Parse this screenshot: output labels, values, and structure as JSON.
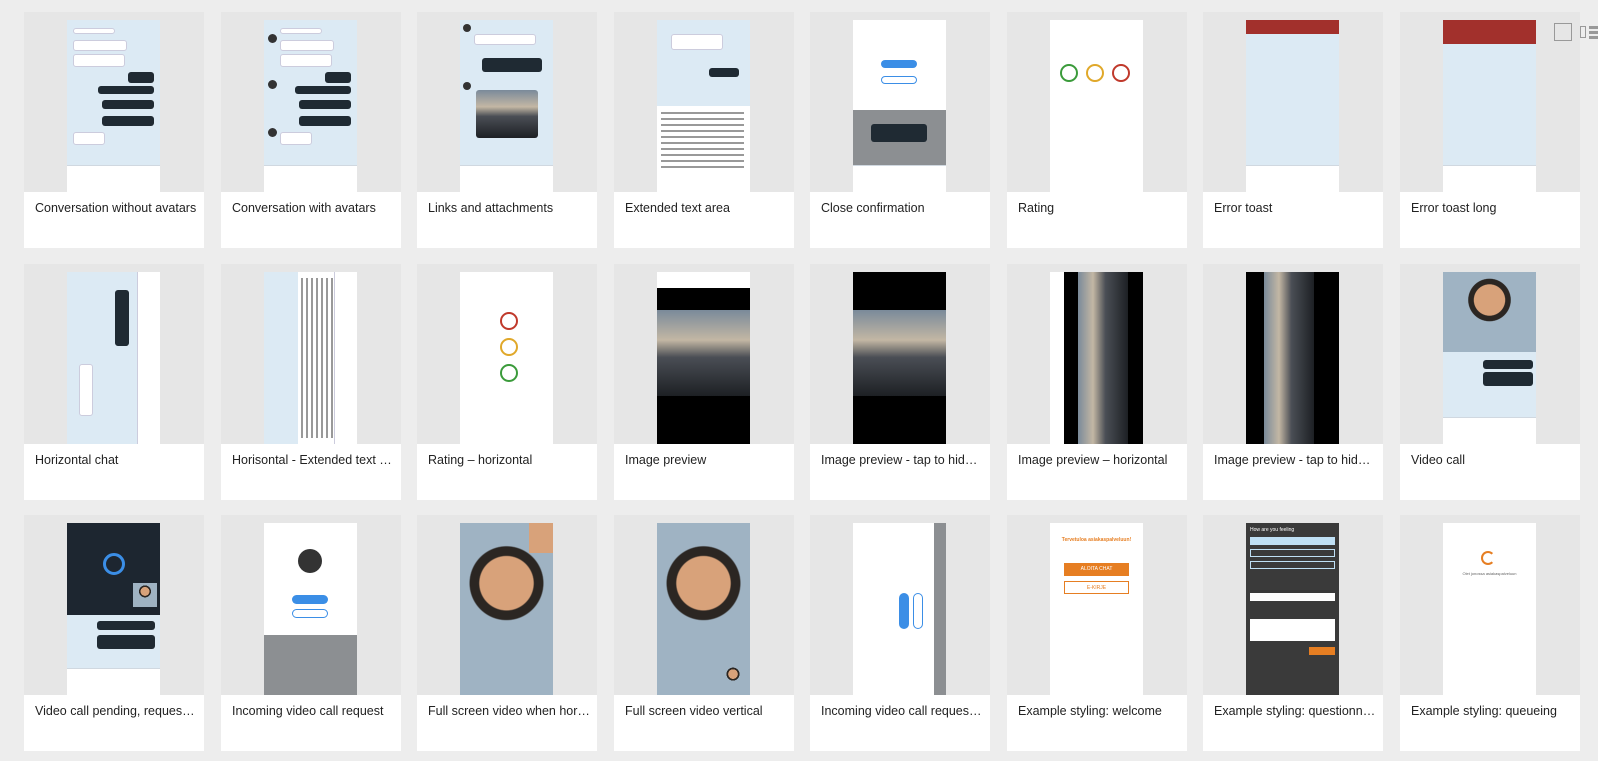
{
  "toolbar": {
    "grid_view_icon": "grid-icon",
    "list_view_icon": "list-panel-icon"
  },
  "cards": [
    {
      "title": "Conversation without avatars"
    },
    {
      "title": "Conversation with avatars"
    },
    {
      "title": "Links and attachments"
    },
    {
      "title": "Extended text area"
    },
    {
      "title": "Close confirmation"
    },
    {
      "title": "Rating"
    },
    {
      "title": "Error toast"
    },
    {
      "title": "Error toast long"
    },
    {
      "title": "Horizontal chat"
    },
    {
      "title": "Horisontal - Extended text ar..."
    },
    {
      "title": "Rating – horizontal"
    },
    {
      "title": "Image preview"
    },
    {
      "title": "Image preview - tap to hide t..."
    },
    {
      "title": "Image preview – horizontal"
    },
    {
      "title": "Image preview - tap to hide t..."
    },
    {
      "title": "Video call"
    },
    {
      "title": "Video call pending, request s..."
    },
    {
      "title": "Incoming video call request"
    },
    {
      "title": "Full screen video when horiz..."
    },
    {
      "title": "Full screen video  vertical"
    },
    {
      "title": "Incoming video call request ..."
    },
    {
      "title": "Example styling: welcome"
    },
    {
      "title": "Example styling: questionnaire"
    },
    {
      "title": "Example styling: queueing"
    }
  ],
  "thumb_text": {
    "welcome_heading": "Tervetuloa asiakaspalveluun!",
    "welcome_button": "ALOITA CHAT",
    "welcome_button2": "E-KIRJE",
    "questionnaire_heading": "How are you feeling",
    "queue_text": "Olet jonossa asiakaspalveluun"
  }
}
